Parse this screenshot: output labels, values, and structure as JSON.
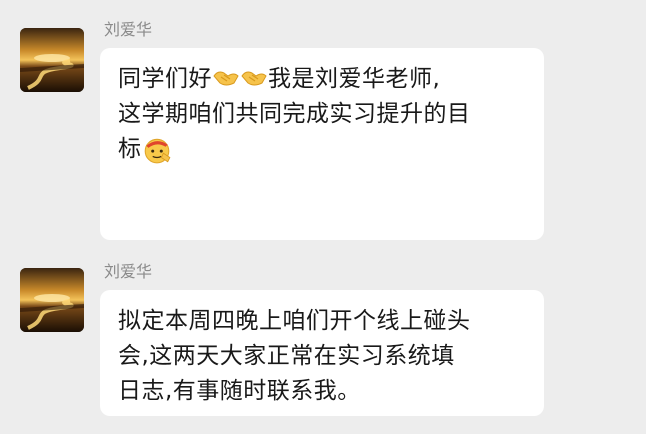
{
  "messages": [
    {
      "sender": "刘爱华",
      "avatar_icon": "sunset-river-avatar",
      "text_line1_a": "同学们好",
      "emoji_1": "handshake-icon",
      "emoji_2": "handshake-icon",
      "text_line1_b": "我是刘爱华老师,",
      "text_line2": "这学期咱们共同完成实习提升的目",
      "text_line3": "标",
      "emoji_3": "saluting-face-icon"
    },
    {
      "sender": "刘爱华",
      "avatar_icon": "sunset-river-avatar",
      "text_line1": "拟定本周四晚上咱们开个线上碰头",
      "text_line2": "会,这两天大家正常在实习系统填",
      "text_line3": "日志,有事随时联系我。"
    }
  ],
  "colors": {
    "background": "#ededed",
    "bubble": "#ffffff",
    "sender": "#8a8a8a",
    "text": "#191919"
  }
}
